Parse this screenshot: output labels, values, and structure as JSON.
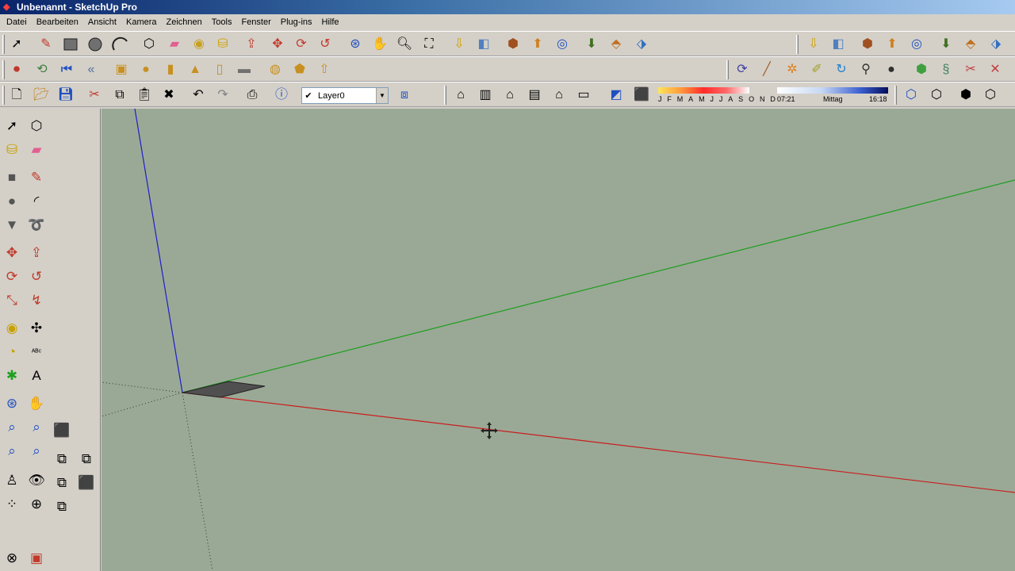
{
  "window": {
    "title": "Unbenannt - SketchUp Pro"
  },
  "menu": [
    "Datei",
    "Bearbeiten",
    "Ansicht",
    "Kamera",
    "Zeichnen",
    "Tools",
    "Fenster",
    "Plug-ins",
    "Hilfe"
  ],
  "layers": {
    "current": "Layer0"
  },
  "shadows": {
    "months": [
      "J",
      "F",
      "M",
      "A",
      "M",
      "J",
      "J",
      "A",
      "S",
      "O",
      "N",
      "D"
    ],
    "time_start": "07:21",
    "time_mid": "Mittag",
    "time_end": "16:18"
  },
  "colors": {
    "viewport_bg": "#9aa996",
    "axis_red": "#c81e1e",
    "axis_green": "#1e9e1e",
    "axis_blue": "#1e1ec8",
    "window_bg": "#d4d0c8"
  }
}
